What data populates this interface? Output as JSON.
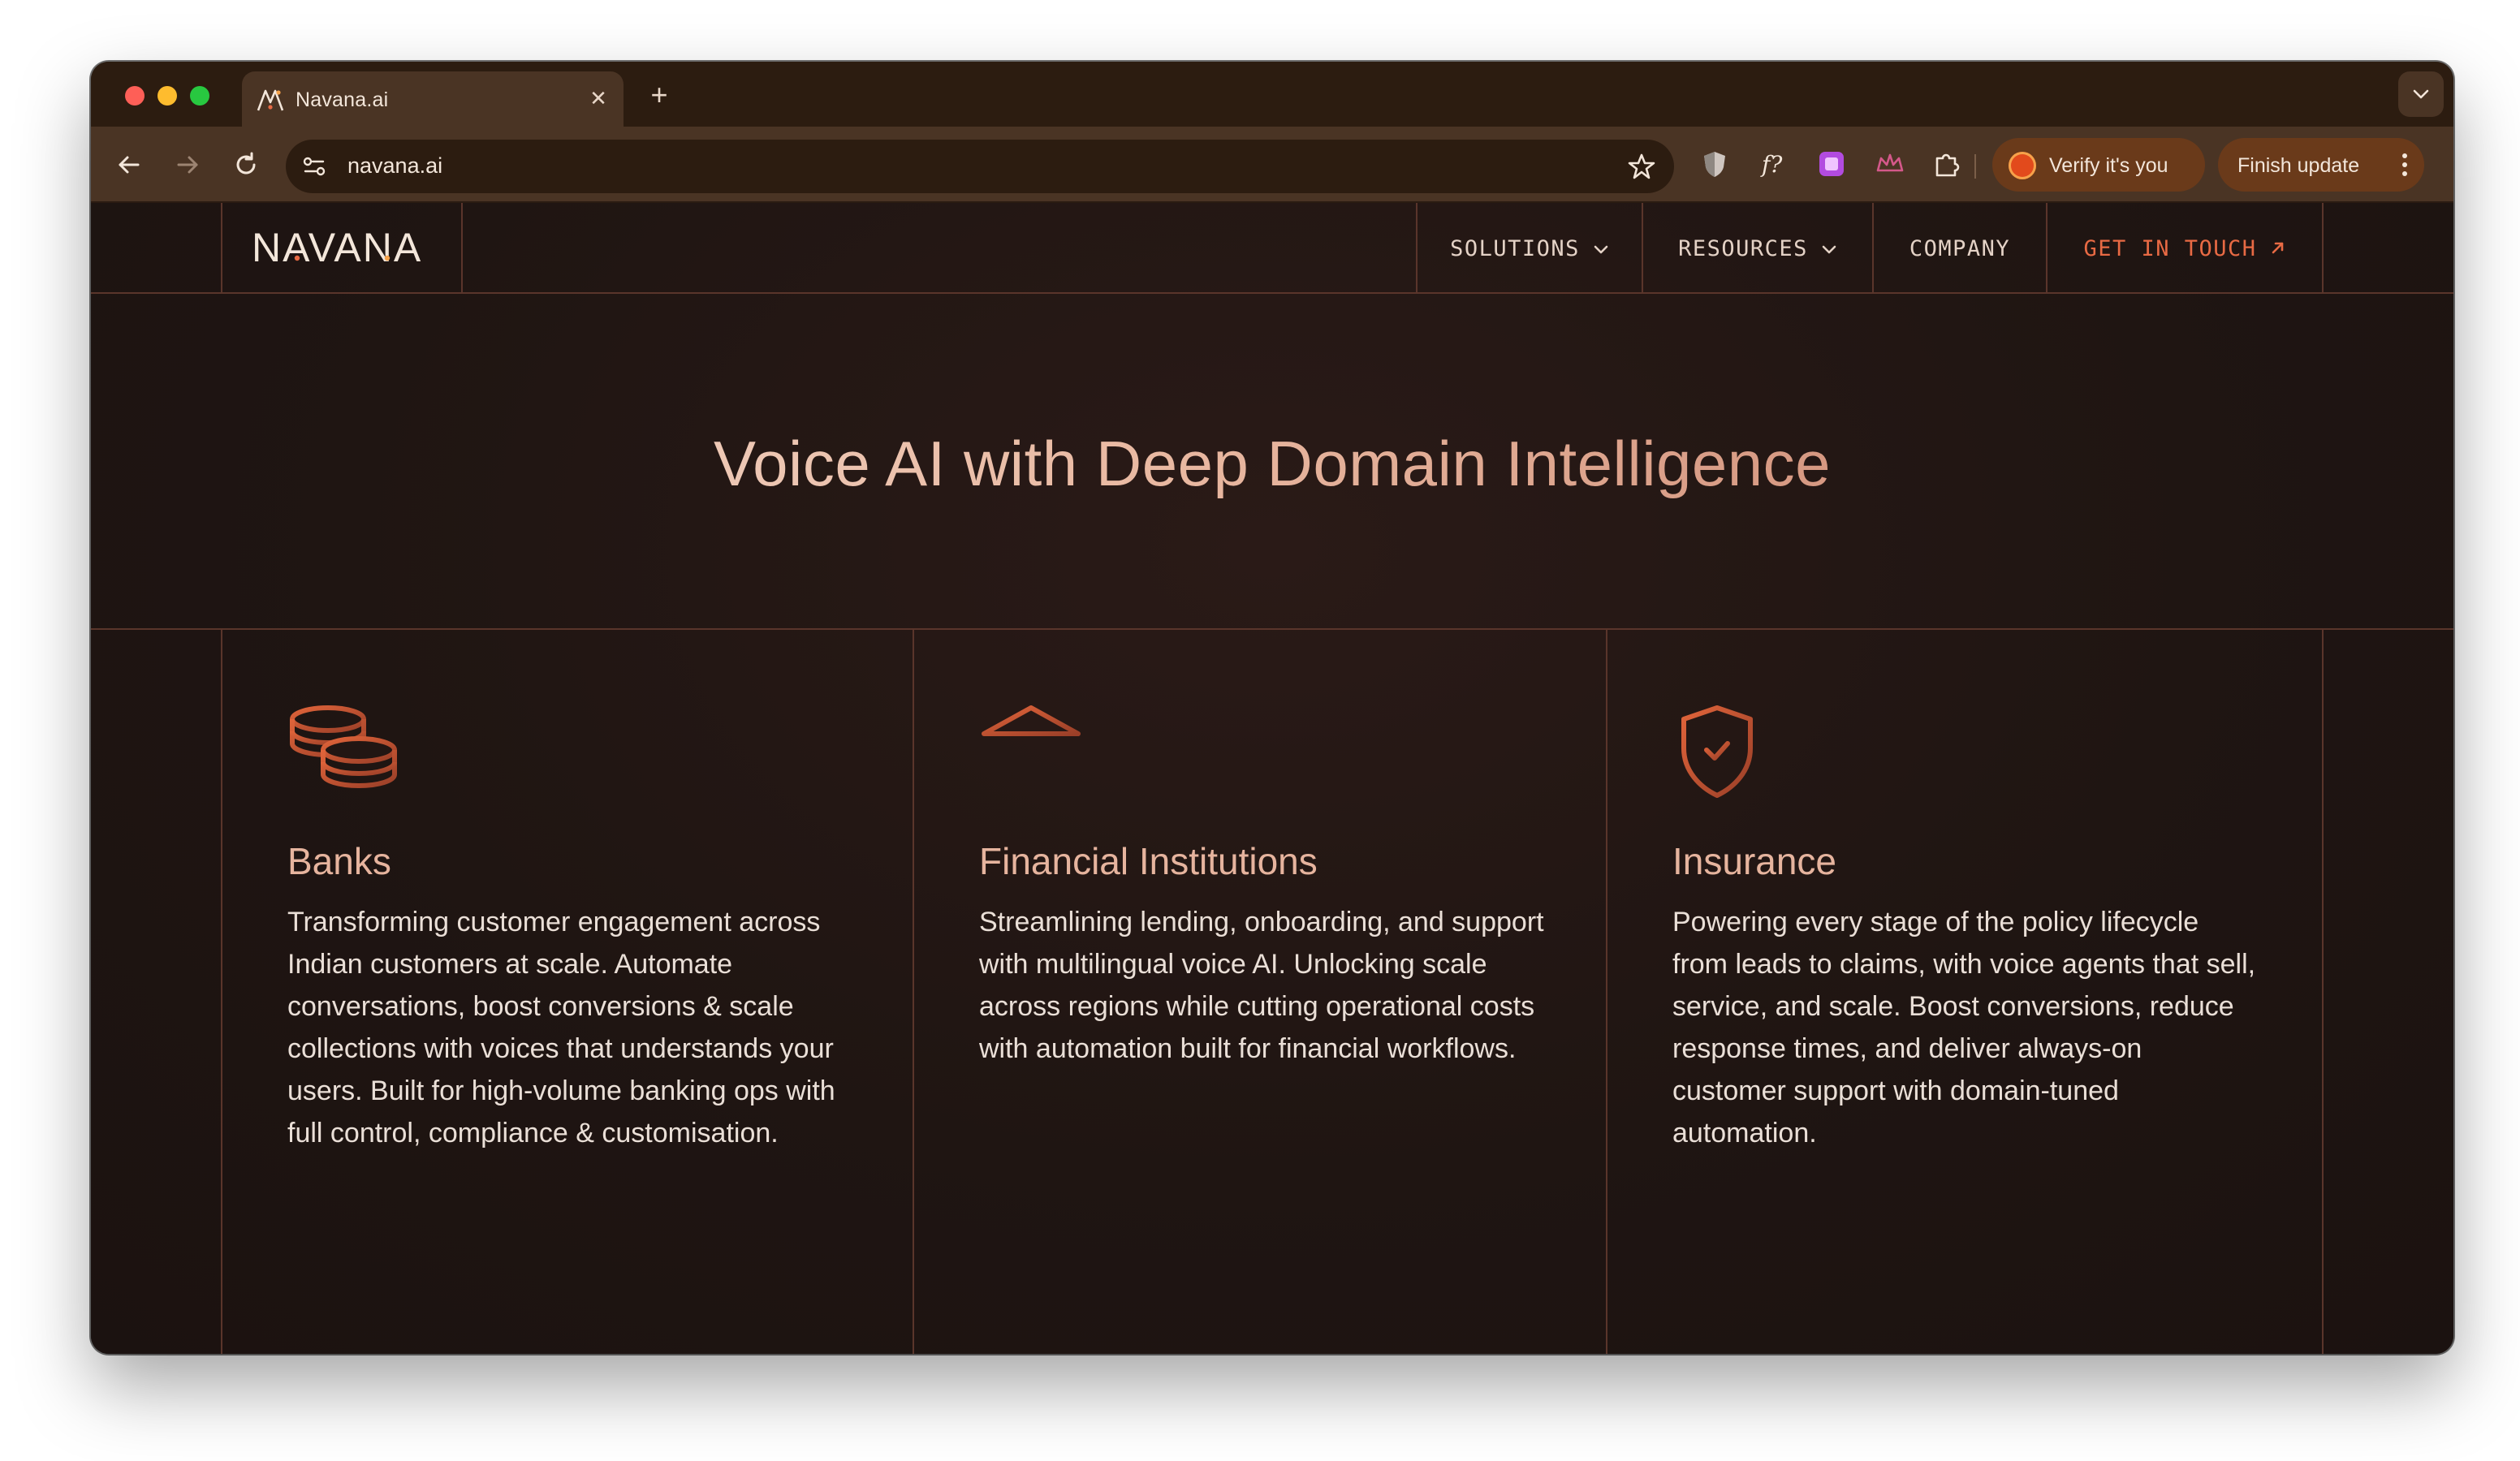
{
  "browser": {
    "tab_title": "Navana.ai",
    "url": "navana.ai",
    "verify_label": "Verify it's you",
    "finish_update_label": "Finish update",
    "icons": [
      "back-arrow-icon",
      "forward-arrow-icon",
      "reload-icon",
      "site-settings-icon",
      "bookmark-star-icon",
      "shield-extension-icon",
      "script-extension-icon",
      "purple-extension-icon",
      "crown-extension-icon",
      "puzzle-extensions-icon",
      "kebab-menu-icon"
    ]
  },
  "site": {
    "logo_text": "NAVANA",
    "nav": {
      "solutions": "SOLUTIONS",
      "resources": "RESOURCES",
      "company": "COMPANY",
      "cta": "GET IN TOUCH"
    }
  },
  "hero": {
    "title": "Voice AI with Deep Domain Intelligence"
  },
  "cards": [
    {
      "icon": "coins-icon",
      "title": "Banks",
      "description": "Transforming customer engagement across Indian customers at scale. Automate conversations, boost conversions & scale collections with voices  that understands your users. Built for high-volume banking ops with full control, compliance & customisation."
    },
    {
      "icon": "bank-building-icon",
      "title": "Financial Institutions",
      "description": "Streamlining lending, onboarding, and support with multilingual voice AI. Unlocking scale across regions while cutting operational costs with automation built for financial workflows."
    },
    {
      "icon": "shield-check-icon",
      "title": "Insurance",
      "description": "Powering every stage of the policy lifecycle from leads to claims, with voice agents that sell, service, and scale. Boost conversions, reduce response times, and deliver always-on customer support with domain-tuned automation."
    }
  ],
  "colors": {
    "accent": "#e86a44",
    "card_title": "#e6b49e",
    "background": "#1f1512",
    "divider": "#5a352b"
  }
}
